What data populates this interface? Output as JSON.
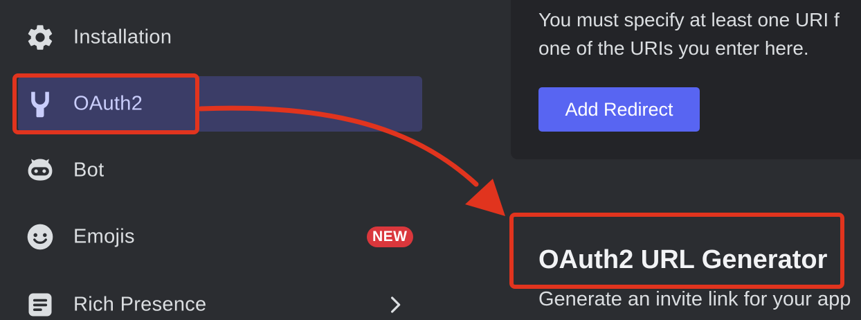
{
  "sidebar": {
    "items": [
      {
        "label": "Installation",
        "icon": "gear-icon"
      },
      {
        "label": "OAuth2",
        "icon": "wrench-icon",
        "active": true
      },
      {
        "label": "Bot",
        "icon": "bot-icon"
      },
      {
        "label": "Emojis",
        "icon": "smiley-icon",
        "badge": "NEW"
      },
      {
        "label": "Rich Presence",
        "icon": "document-icon",
        "chevron": "chevron-right-icon"
      }
    ]
  },
  "redirects": {
    "description_line1": "You must specify at least one URI f",
    "description_line2": "one of the URIs you enter here.",
    "add_button_label": "Add Redirect"
  },
  "url_generator": {
    "title": "OAuth2 URL Generator",
    "description": "Generate an invite link for your app"
  },
  "colors": {
    "background": "#2b2d31",
    "card_background": "#232428",
    "active_item": "#3b3d67",
    "primary_button": "#5865f2",
    "badge_new": "#da373c",
    "annotation": "#e1341e"
  }
}
